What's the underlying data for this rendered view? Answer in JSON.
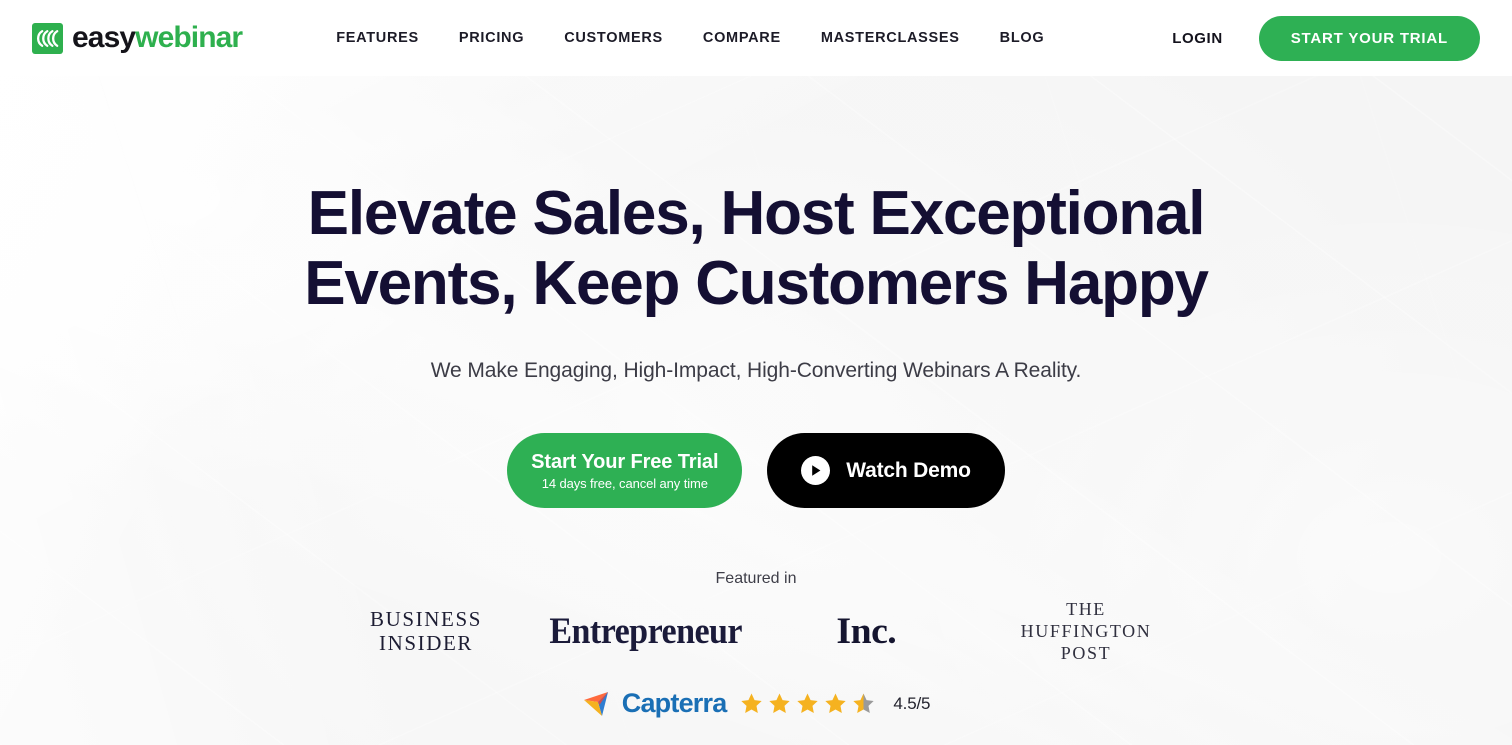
{
  "brand": {
    "name_part1": "easy",
    "name_part2": "webinar",
    "mark_icon": "waves-logo-icon",
    "mark_color": "#2eb04e"
  },
  "nav": {
    "items": [
      {
        "label": "FEATURES"
      },
      {
        "label": "PRICING"
      },
      {
        "label": "CUSTOMERS"
      },
      {
        "label": "COMPARE"
      },
      {
        "label": "MASTERCLASSES"
      },
      {
        "label": "BLOG"
      }
    ],
    "login_label": "LOGIN",
    "trial_label": "START YOUR TRIAL",
    "trial_color": "#2eb054"
  },
  "hero": {
    "title_line1": "Elevate Sales, Host Exceptional",
    "title_line2": "Events, Keep Customers Happy",
    "title_color": "#140f33",
    "subtitle": "We Make Engaging, High-Impact, High-Converting Webinars A Reality.",
    "primary_cta": {
      "label": "Start Your Free Trial",
      "sublabel": "14 days free, cancel any time",
      "color": "#2eb054"
    },
    "secondary_cta": {
      "label": "Watch Demo",
      "icon": "play-icon",
      "color": "#000000"
    },
    "featured_label": "Featured in",
    "press_logos": [
      {
        "name": "business-insider",
        "line1": "BUSINESS",
        "line2": "INSIDER"
      },
      {
        "name": "entrepreneur",
        "text": "Entrepreneur"
      },
      {
        "name": "inc",
        "text": "Inc."
      },
      {
        "name": "huffington-post",
        "line1": "THE",
        "line2": "HUFFINGTON",
        "line3": "POST"
      }
    ],
    "rating": {
      "source": "Capterra",
      "source_color": "#1a6fb5",
      "stars_total": 5,
      "stars_filled": 4,
      "stars_half": 1,
      "star_color": "#f5b220",
      "star_empty_color": "#9a9a9a",
      "value": "4.5/5"
    }
  }
}
